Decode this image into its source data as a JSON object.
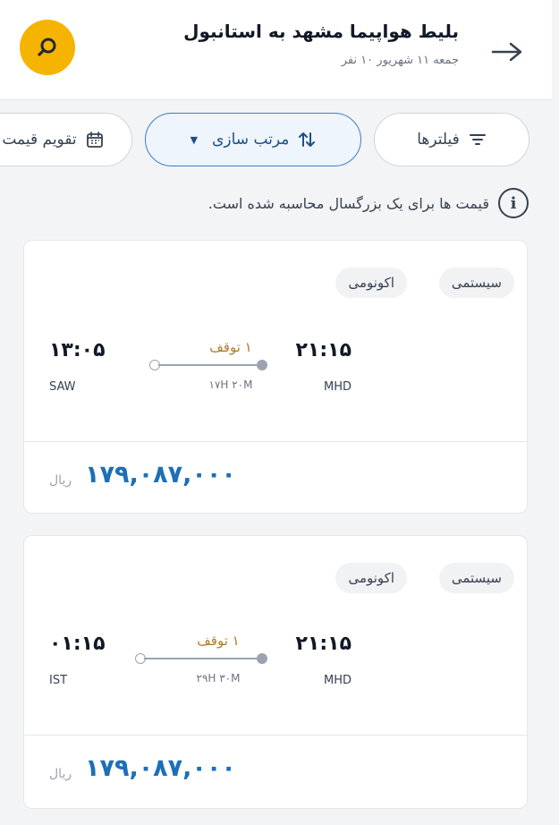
{
  "header": {
    "title": "بلیط هواپیما مشهد به استانبول",
    "subtitle": "جمعه ۱۱ شهریور ۱۰ نفر"
  },
  "chips": {
    "filters": "فیلترها",
    "sort": "مرتب سازی",
    "calendar": "تقویم قیمت"
  },
  "info": {
    "text": "قیمت ها برای یک بزرگسال محاسبه شده است."
  },
  "flights": [
    {
      "type": "سیستمی",
      "cabin": "اکونومی",
      "depart_time": "۲۱:۱۵",
      "depart_code": "MHD",
      "arrive_time": "۱۳:۰۵",
      "arrive_code": "SAW",
      "stops": "۱ توقف",
      "duration": "۱۷H ۲۰M",
      "price": "۱۷۹,۰۸۷,۰۰۰",
      "currency": "ریال"
    },
    {
      "type": "سیستمی",
      "cabin": "اکونومی",
      "depart_time": "۲۱:۱۵",
      "depart_code": "MHD",
      "arrive_time": "۰۱:۱۵",
      "arrive_code": "IST",
      "stops": "۱ توقف",
      "duration": "۲۹H ۳۰M",
      "price": "۱۷۹,۰۸۷,۰۰۰",
      "currency": "ریال"
    }
  ],
  "colors": {
    "accent_yellow": "#f5b400",
    "price_blue": "#1d6fb8",
    "sort_border": "#3b7fc4",
    "stop_text": "#b07a2a"
  }
}
